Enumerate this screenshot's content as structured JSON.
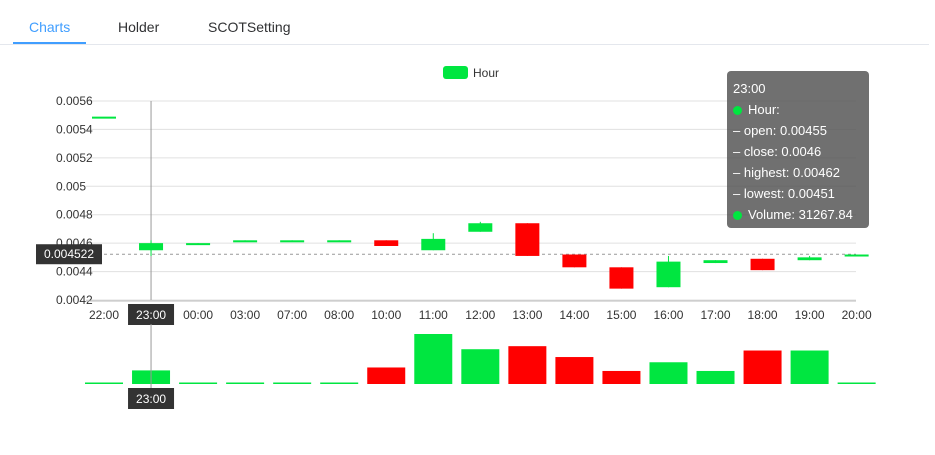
{
  "tabs": [
    {
      "label": "Charts",
      "active": true
    },
    {
      "label": "Holder",
      "active": false
    },
    {
      "label": "SCOTSetting",
      "active": false
    }
  ],
  "colors": {
    "up": "#00e640",
    "down": "#ff0000",
    "accent": "#409eff"
  },
  "chart_data": {
    "type": "candlestick",
    "legend": {
      "label": "Hour",
      "placement": "top-center"
    },
    "categories": [
      "22:00",
      "23:00",
      "00:00",
      "03:00",
      "07:00",
      "08:00",
      "10:00",
      "11:00",
      "12:00",
      "13:00",
      "14:00",
      "15:00",
      "16:00",
      "17:00",
      "18:00",
      "19:00",
      "20:00"
    ],
    "series": [
      {
        "name": "Hour",
        "ohlc": [
          [
            0.00549,
            0.00549,
            0.00549,
            0.00549
          ],
          [
            0.00455,
            0.0046,
            0.00462,
            0.00451
          ],
          [
            0.00459,
            0.0046,
            0.0046,
            0.00459
          ],
          [
            0.00461,
            0.00462,
            0.00462,
            0.00461
          ],
          [
            0.00461,
            0.00462,
            0.00462,
            0.00461
          ],
          [
            0.00461,
            0.00462,
            0.00462,
            0.00461
          ],
          [
            0.00462,
            0.00458,
            0.00462,
            0.00458
          ],
          [
            0.00455,
            0.00463,
            0.00467,
            0.00455
          ],
          [
            0.00468,
            0.00474,
            0.00475,
            0.00468
          ],
          [
            0.00474,
            0.00451,
            0.00474,
            0.00451
          ],
          [
            0.00452,
            0.00443,
            0.00452,
            0.00443
          ],
          [
            0.00443,
            0.00428,
            0.00443,
            0.00428
          ],
          [
            0.00429,
            0.00447,
            0.00451,
            0.00429
          ],
          [
            0.00446,
            0.00448,
            0.00448,
            0.00446
          ],
          [
            0.00449,
            0.00441,
            0.00449,
            0.00441
          ],
          [
            0.00448,
            0.0045,
            0.00451,
            0.00448
          ],
          [
            0.00451,
            0.00452,
            0.00452,
            0.00451
          ]
        ],
        "volume": [
          0,
          31267.84,
          2000,
          0,
          0,
          0,
          38000,
          115000,
          80000,
          87000,
          62000,
          30000,
          50000,
          30000,
          77000,
          77000,
          2000
        ]
      }
    ],
    "y_ticks": [
      "0.0042",
      "0.0044",
      "0.0046",
      "0.0048",
      "0.005",
      "0.0052",
      "0.0054",
      "0.0056"
    ],
    "ylim": [
      0.0042,
      0.0056
    ],
    "grid": true,
    "crosshair": {
      "x_label": "23:00",
      "y_label": "0.004522",
      "volume_x_label": "23:00"
    }
  },
  "tooltip": {
    "time": "23:00",
    "series_label": "Hour:",
    "open": "– open: 0.00455",
    "close": "– close: 0.0046",
    "highest": "– highest: 0.00462",
    "lowest": "– lowest: 0.00451",
    "volume": "Volume: 31267.84"
  }
}
